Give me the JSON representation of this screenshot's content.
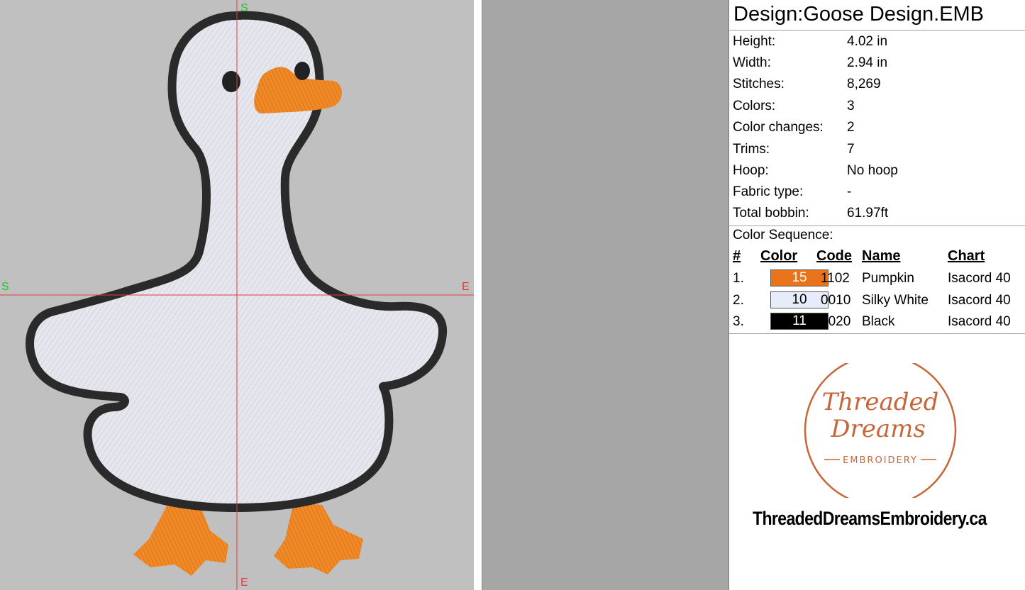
{
  "markers": {
    "start": "S",
    "end": "E"
  },
  "design": {
    "title": "Design:Goose Design.EMB",
    "fields": [
      {
        "label": "Height:",
        "value": "4.02 in"
      },
      {
        "label": "Width:",
        "value": "2.94 in"
      },
      {
        "label": "Stitches:",
        "value": "8,269"
      },
      {
        "label": "Colors:",
        "value": "3"
      },
      {
        "label": "Color changes:",
        "value": "2"
      },
      {
        "label": "Trims:",
        "value": "7"
      },
      {
        "label": "Hoop:",
        "value": "No hoop"
      },
      {
        "label": "Fabric type:",
        "value": "-"
      },
      {
        "label": "Total bobbin:",
        "value": "61.97ft"
      }
    ]
  },
  "color_sequence": {
    "label": "Color Sequence:",
    "headers": {
      "num": "#",
      "color": "Color",
      "code": "Code",
      "name": "Name",
      "chart": "Chart"
    },
    "rows": [
      {
        "num": "1.",
        "swatch": "15",
        "swatch_color": "#e8731a",
        "swatch_text_color": "#ffffff",
        "code": "1102",
        "name": "Pumpkin",
        "chart": "Isacord 40"
      },
      {
        "num": "2.",
        "swatch": "10",
        "swatch_color": "#e6ecfa",
        "swatch_text_color": "#000000",
        "code": "0010",
        "name": "Silky White",
        "chart": "Isacord 40"
      },
      {
        "num": "3.",
        "swatch": "11",
        "swatch_color": "#000000",
        "swatch_text_color": "#ffffff",
        "code": "0020",
        "name": "Black",
        "chart": "Isacord 40"
      }
    ]
  },
  "logo": {
    "line1": "Threaded",
    "line2": "Dreams",
    "line3": "EMBROIDERY",
    "color": "#c8663a"
  },
  "website": "ThreadedDreamsEmbroidery.ca",
  "colors": {
    "canvas": "#c0c0c0",
    "guide": "#e03c3c",
    "marker": "#1ec81e",
    "marker_end": "#e03c3c",
    "goose_body": "#e8e8f0",
    "outline": "#2a2a2a",
    "orange": "#f08a28"
  }
}
